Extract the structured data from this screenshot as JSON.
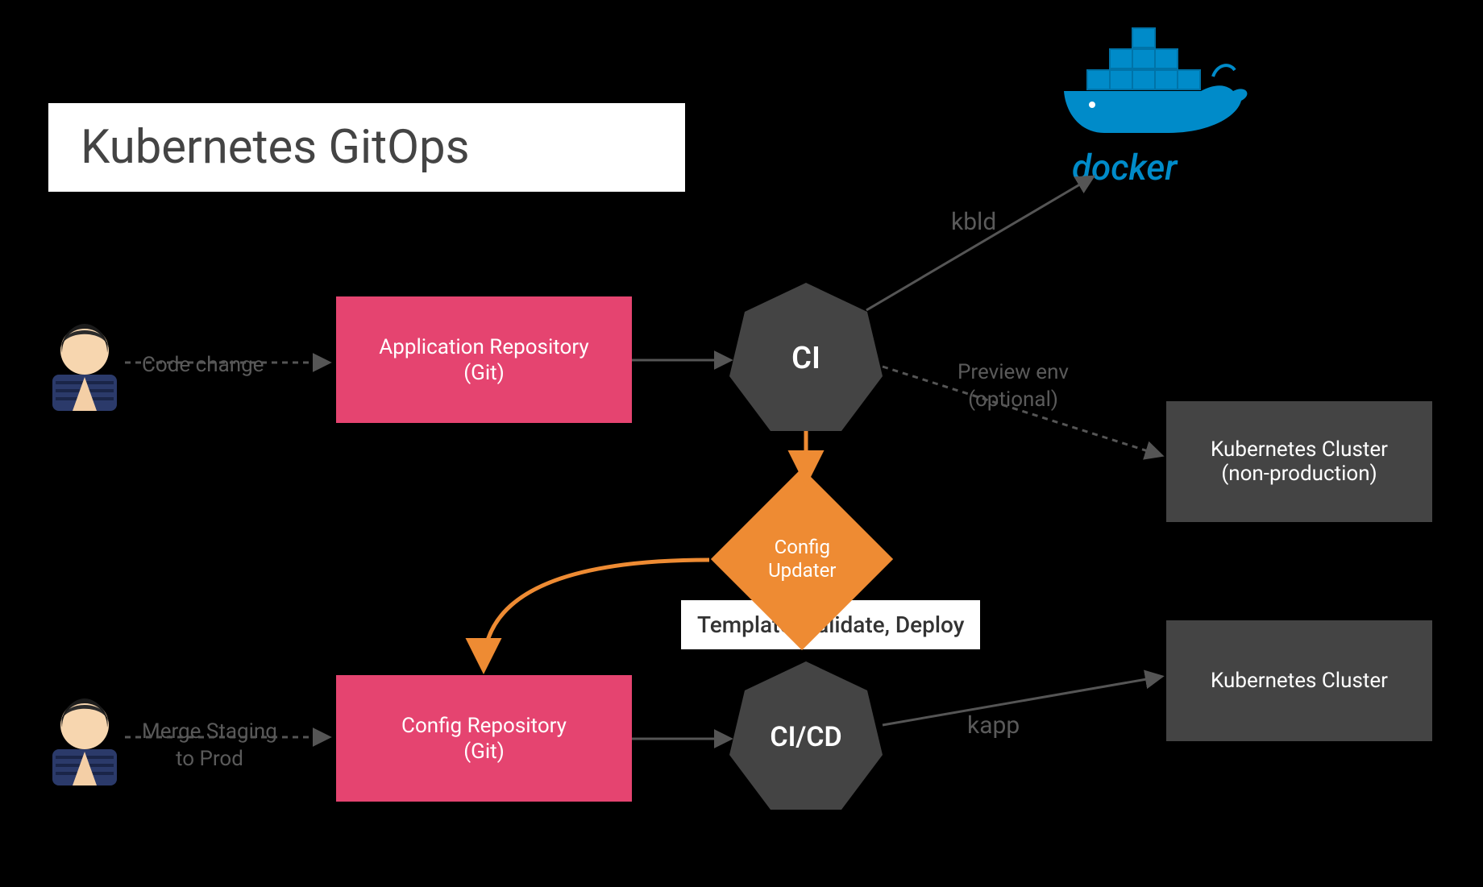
{
  "title": "Kubernetes GitOps",
  "actors": {
    "top": {
      "label": "Code change"
    },
    "bottom": {
      "label_l1": "Merge Staging",
      "label_l2": "to Prod"
    }
  },
  "repos": {
    "app": {
      "l1": "Application Repository",
      "l2": "(Git)"
    },
    "config": {
      "l1": "Config Repository",
      "l2": "(Git)"
    }
  },
  "nodes": {
    "ci": "CI",
    "cicd": "CI/CD",
    "config_updater_l1": "Config",
    "config_updater_l2": "Updater"
  },
  "edges": {
    "kbld": "kbld",
    "preview_l1": "Preview env",
    "preview_l2": "(optional)",
    "kapp": "kapp",
    "template_validate_deploy": "Template, Validate, Deploy"
  },
  "clusters": {
    "nonprod_l1": "Kubernetes Cluster",
    "nonprod_l2": "(non-production)",
    "prod": "Kubernetes Cluster"
  },
  "docker_label": "docker"
}
